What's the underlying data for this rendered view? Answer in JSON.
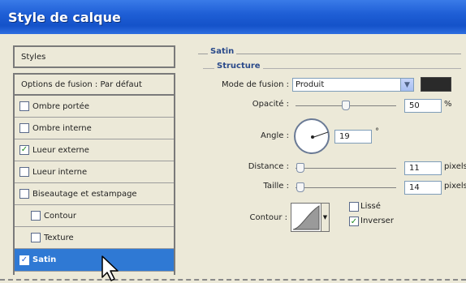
{
  "window": {
    "title": "Style de calque"
  },
  "left": {
    "styles_label": "Styles",
    "options_label": "Options de fusion : Par défaut",
    "items": [
      {
        "label": "Ombre portée",
        "checked": false
      },
      {
        "label": "Ombre interne",
        "checked": false
      },
      {
        "label": "Lueur externe",
        "checked": true
      },
      {
        "label": "Lueur interne",
        "checked": false
      },
      {
        "label": "Biseautage et estampage",
        "checked": false
      },
      {
        "label": "Contour",
        "checked": false
      },
      {
        "label": "Texture",
        "checked": false
      },
      {
        "label": "Satin",
        "checked": true
      }
    ]
  },
  "satin": {
    "section_title": "Satin",
    "structure_title": "Structure",
    "blend_mode_label": "Mode de fusion :",
    "blend_mode_value": "Produit",
    "color": "#2a2a2a",
    "opacity_label": "Opacité :",
    "opacity_value": "50",
    "opacity_unit": "%",
    "opacity_fraction": 0.5,
    "angle_label": "Angle :",
    "angle_value": "19",
    "angle_unit": "°",
    "distance_label": "Distance :",
    "distance_value": "11",
    "distance_unit": "pixels",
    "distance_fraction": 0.05,
    "size_label": "Taille :",
    "size_value": "14",
    "size_unit": "pixels",
    "size_fraction": 0.05,
    "contour_label": "Contour :",
    "antialias_label": "Lissé",
    "antialias_checked": false,
    "invert_label": "Inverser",
    "invert_checked": true
  },
  "colors": {
    "accent": "#2f79d4",
    "title_bar": "#1f5fd6",
    "panel_bg": "#ece9d8"
  },
  "icons": [
    "check-icon",
    "chevron-down-icon",
    "arrow-cursor-icon"
  ]
}
